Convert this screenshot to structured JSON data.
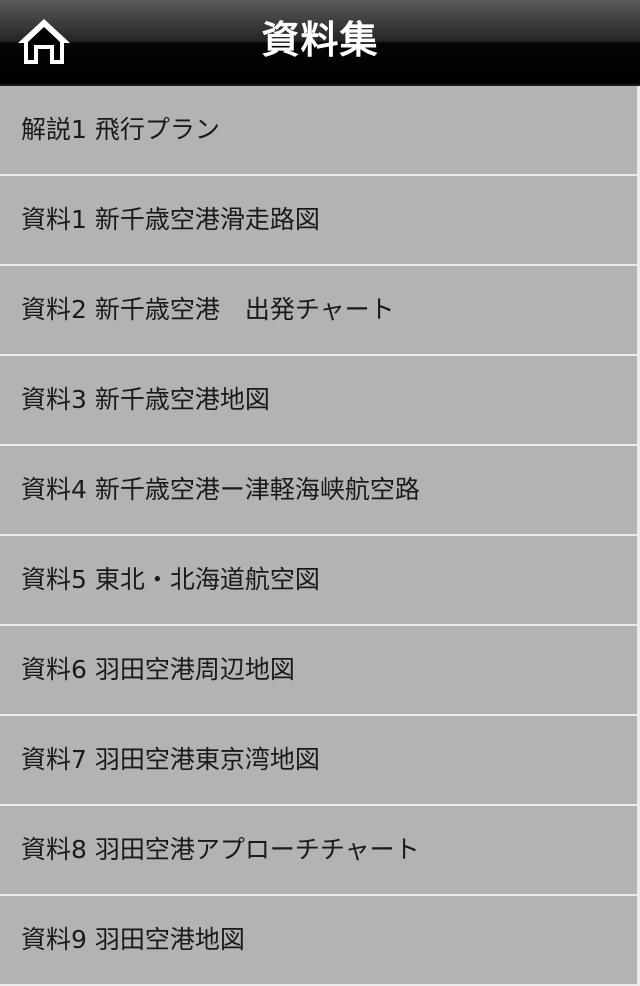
{
  "header": {
    "title": "資料集",
    "home_icon": "home-icon"
  },
  "items": [
    {
      "label": "解説1 飛行プラン"
    },
    {
      "label": "資料1 新千歳空港滑走路図"
    },
    {
      "label": "資料2 新千歳空港　出発チャート"
    },
    {
      "label": "資料3 新千歳空港地図"
    },
    {
      "label": "資料4 新千歳空港ー津軽海峡航空路"
    },
    {
      "label": "資料5 東北・北海道航空図"
    },
    {
      "label": "資料6 羽田空港周辺地図"
    },
    {
      "label": "資料7 羽田空港東京湾地図"
    },
    {
      "label": "資料8 羽田空港アプローチチャート"
    },
    {
      "label": "資料9 羽田空港地図"
    }
  ],
  "colors": {
    "header_bg": "#000000",
    "list_bg": "#b3b3b3",
    "separator": "#ececec",
    "text": "#1a1a1a"
  }
}
